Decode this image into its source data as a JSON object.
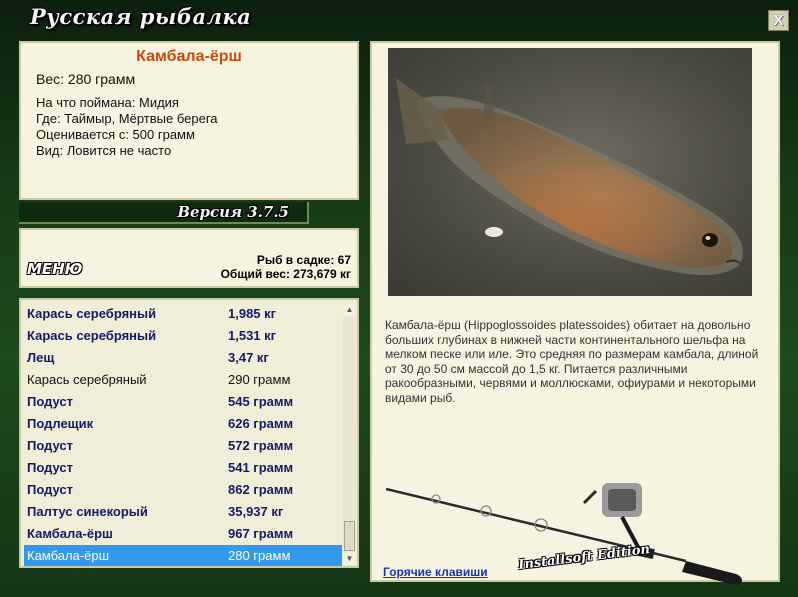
{
  "app": {
    "title": "Русская рыбалка",
    "close_label": "X",
    "version": "Версия 3.7.5",
    "edition": "Installsoft Edition"
  },
  "fish_info": {
    "name": "Камбала-ёрш",
    "weight": "Вес: 280 грамм",
    "caught_on": "На что поймана: Мидия",
    "location": "Где: Таймыр, Мёртвые берега",
    "valued_from": "Оценивается с: 500 грамм",
    "frequency": "Вид: Ловится не часто"
  },
  "menu": {
    "label": "МЕНЮ"
  },
  "stats": {
    "fish_in_keepnet": "Рыб в садке: 67",
    "total_weight": "Общий вес: 273,679 кг"
  },
  "catch_list": [
    {
      "name": "Карась серебряный",
      "weight": "1,985 кг",
      "highlight": true
    },
    {
      "name": "Карась серебряный",
      "weight": "1,531 кг",
      "highlight": true
    },
    {
      "name": "Лещ",
      "weight": "3,47 кг",
      "highlight": true
    },
    {
      "name": "Карась серебряный",
      "weight": "290 грамм",
      "highlight": false
    },
    {
      "name": "Подуст",
      "weight": "545 грамм",
      "highlight": true
    },
    {
      "name": "Подлещик",
      "weight": "626 грамм",
      "highlight": true
    },
    {
      "name": "Подуст",
      "weight": "572 грамм",
      "highlight": true
    },
    {
      "name": "Подуст",
      "weight": "541 грамм",
      "highlight": true
    },
    {
      "name": "Подуст",
      "weight": "862 грамм",
      "highlight": true
    },
    {
      "name": "Палтус синекорый",
      "weight": "35,937 кг",
      "highlight": true
    },
    {
      "name": "Камбала-ёрш",
      "weight": "967 грамм",
      "highlight": true
    },
    {
      "name": "Камбала-ёрш",
      "weight": "280 грамм",
      "highlight": false,
      "selected": true
    }
  ],
  "description": "Камбала-ёрш (Hippoglossoides platessoides) обитает на довольно больших глубинах в нижней части континентального шельфа на мелком песке или иле. Это средняя по размерам камбала, длиной от 30 до 50 см массой до 1,5 кг. Питается различными ракообразными, червями и моллюсками, офиурами и некоторыми видами рыб.",
  "hotkeys_label": "Горячие клавиши",
  "icons": {
    "close": "close-icon",
    "scroll_up": "triangle-up-icon",
    "scroll_down": "triangle-down-icon"
  },
  "colors": {
    "fish_name": "#c64a10",
    "list_highlight": "#141a66",
    "selection": "#3399ee",
    "link": "#1a33b5"
  }
}
